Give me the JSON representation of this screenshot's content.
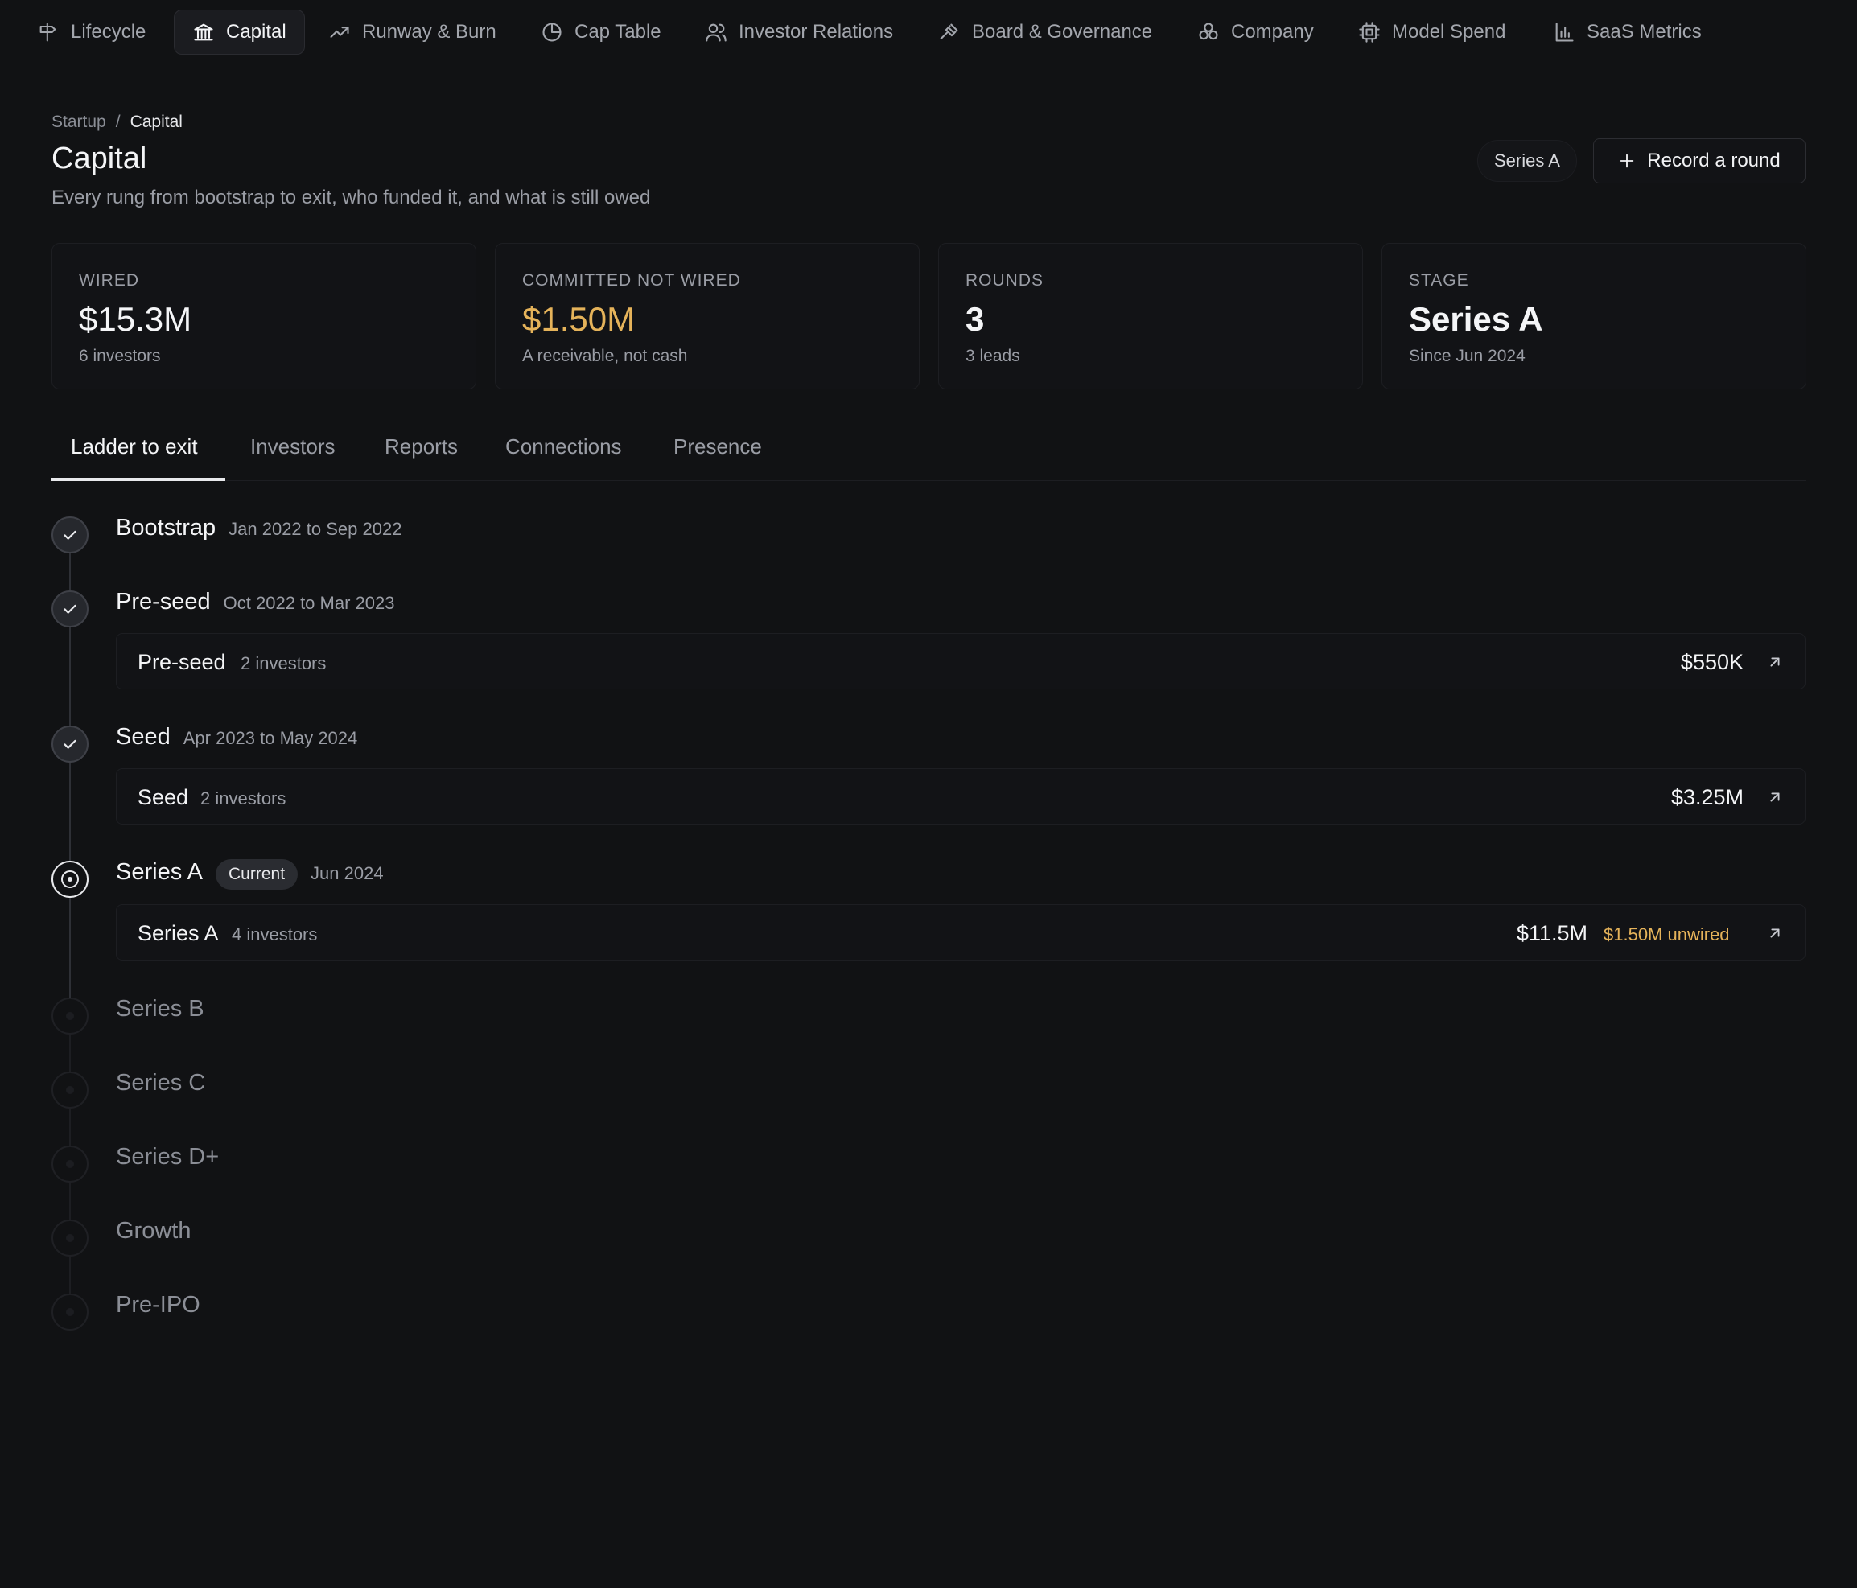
{
  "nav": {
    "items": [
      {
        "label": "Lifecycle",
        "icon": "signpost-icon"
      },
      {
        "label": "Capital",
        "icon": "bank-icon"
      },
      {
        "label": "Runway & Burn",
        "icon": "trending-up-icon"
      },
      {
        "label": "Cap Table",
        "icon": "pie-chart-icon"
      },
      {
        "label": "Investor Relations",
        "icon": "users-icon"
      },
      {
        "label": "Board & Governance",
        "icon": "gavel-icon"
      },
      {
        "label": "Company",
        "icon": "company-cluster-icon"
      },
      {
        "label": "Model Spend",
        "icon": "chip-icon"
      },
      {
        "label": "SaaS Metrics",
        "icon": "bar-chart-icon"
      }
    ],
    "active": "Capital"
  },
  "header": {
    "breadcrumb": {
      "root": "Startup",
      "separator": "/",
      "current": "Capital"
    },
    "title": "Capital",
    "subtitle": "Every rung from bootstrap to exit, who funded it, and what is still owed",
    "stage_pill": "Series A",
    "record_button": "Record a round"
  },
  "stats": [
    {
      "label": "Wired",
      "value": "$15.3M",
      "note": "6 investors"
    },
    {
      "label": "Committed not wired",
      "value": "$1.50M",
      "note": "A receivable, not cash"
    },
    {
      "label": "Rounds",
      "value": "3",
      "note": "3 leads"
    },
    {
      "label": "Stage",
      "value": "Series A",
      "note": "Since Jun 2024"
    }
  ],
  "tabs": [
    {
      "label": "Ladder to exit"
    },
    {
      "label": "Investors"
    },
    {
      "label": "Reports"
    },
    {
      "label": "Connections"
    },
    {
      "label": "Presence"
    }
  ],
  "ladder": {
    "stages": [
      {
        "name": "Bootstrap",
        "dates": "Jan 2022 to Sep 2022",
        "status": "done"
      },
      {
        "name": "Pre-seed",
        "dates": "Oct 2022 to Mar 2023",
        "status": "done",
        "round": {
          "name": "Pre-seed",
          "investors": "2 investors",
          "amount": "$550K"
        }
      },
      {
        "name": "Seed",
        "dates": "Apr 2023 to May 2024",
        "status": "done",
        "round": {
          "name": "Seed",
          "investors": "2 investors",
          "amount": "$3.25M"
        }
      },
      {
        "name": "Series A",
        "badge": "Current",
        "dates": "Jun 2024",
        "status": "current",
        "round": {
          "name": "Series A",
          "investors": "4 investors",
          "amount": "$11.5M",
          "unwired": "$1.50M unwired"
        }
      },
      {
        "name": "Series B",
        "status": "future"
      },
      {
        "name": "Series C",
        "status": "future"
      },
      {
        "name": "Series D+",
        "status": "future"
      },
      {
        "name": "Growth",
        "status": "future"
      },
      {
        "name": "Pre-IPO",
        "status": "future"
      }
    ]
  },
  "colors": {
    "background": "#111214",
    "accent_amber": "#e5b35a",
    "text_primary": "#f4f5f7",
    "text_muted": "#9a9da5"
  }
}
